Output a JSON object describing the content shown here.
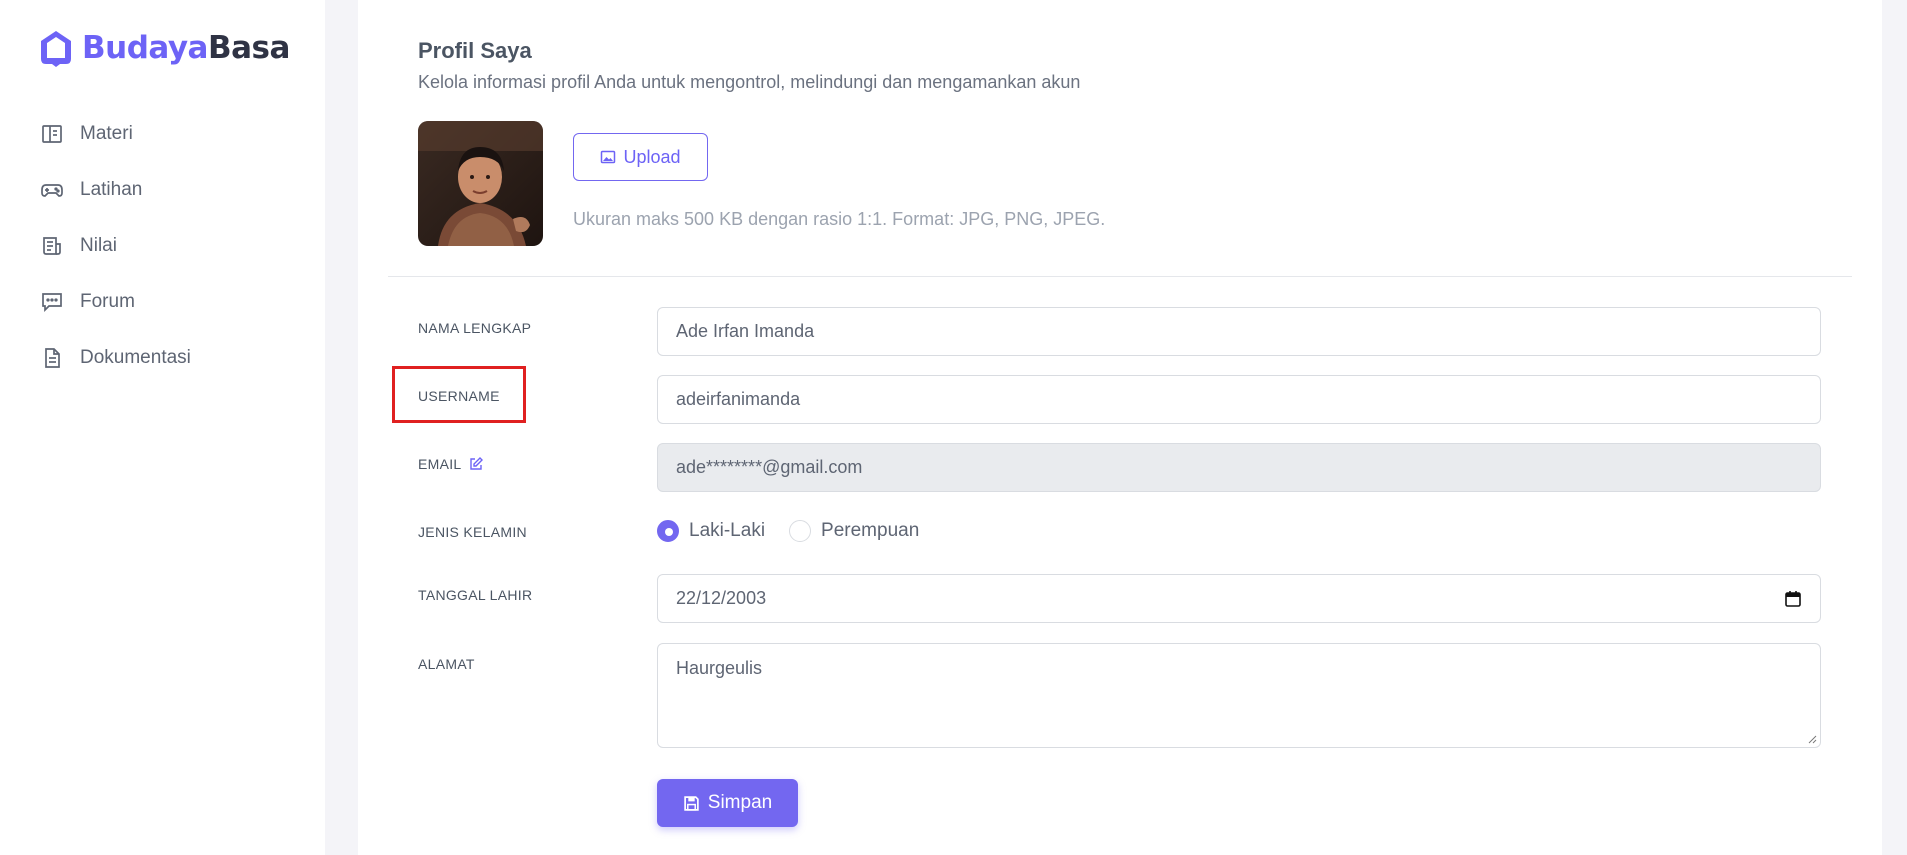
{
  "brand": {
    "part1": "Budaya",
    "part2": "Basa"
  },
  "sidebar": {
    "items": [
      {
        "label": "Materi",
        "icon": "book-open-icon"
      },
      {
        "label": "Latihan",
        "icon": "gamepad-icon"
      },
      {
        "label": "Nilai",
        "icon": "report-icon"
      },
      {
        "label": "Forum",
        "icon": "chat-icon"
      },
      {
        "label": "Dokumentasi",
        "icon": "document-icon"
      }
    ]
  },
  "profile": {
    "title": "Profil Saya",
    "subtitle": "Kelola informasi profil Anda untuk mengontrol, melindungi dan mengamankan akun",
    "upload_label": "Upload",
    "upload_hint": "Ukuran maks 500 KB dengan rasio 1:1. Format: JPG, PNG, JPEG."
  },
  "form": {
    "full_name": {
      "label": "NAMA LENGKAP",
      "value": "Ade Irfan Imanda"
    },
    "username": {
      "label": "USERNAME",
      "value": "adeirfanimanda"
    },
    "email": {
      "label": "EMAIL",
      "value": "ade********@gmail.com"
    },
    "gender": {
      "label": "JENIS KELAMIN",
      "options": [
        "Laki-Laki",
        "Perempuan"
      ],
      "selected": "Laki-Laki"
    },
    "birth_date": {
      "label": "TANGGAL LAHIR",
      "value": "22/12/2003"
    },
    "address": {
      "label": "ALAMAT",
      "value": "Haurgeulis"
    },
    "save_label": "Simpan"
  },
  "colors": {
    "accent": "#7367f0",
    "highlight": "#e02020"
  }
}
